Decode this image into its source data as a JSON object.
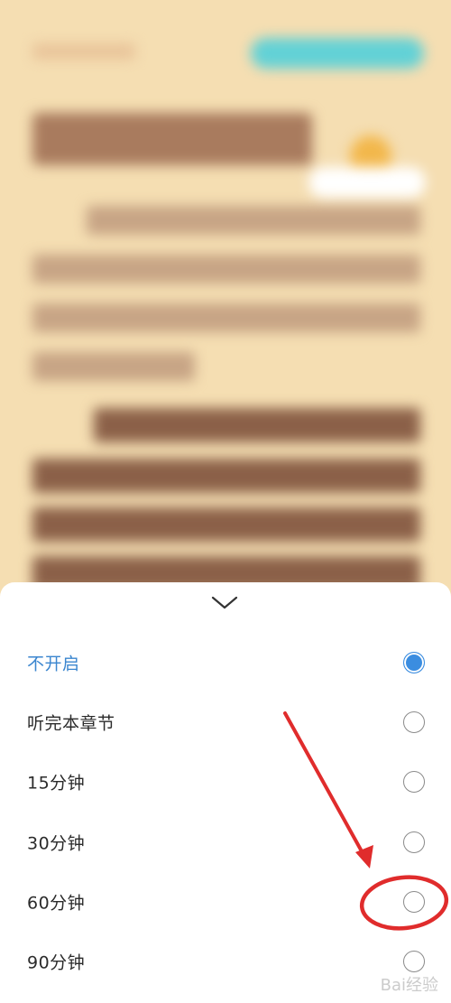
{
  "sheet": {
    "collapse_icon": "chevron-down-icon",
    "options": [
      {
        "label": "不开启",
        "selected": true
      },
      {
        "label": "听完本章节",
        "selected": false
      },
      {
        "label": "15分钟",
        "selected": false
      },
      {
        "label": "30分钟",
        "selected": false
      },
      {
        "label": "60分钟",
        "selected": false
      },
      {
        "label": "90分钟",
        "selected": false
      }
    ]
  },
  "colors": {
    "accent": "#3b8de0",
    "selected_text": "#3b86cf",
    "annotation": "#e02c2c",
    "page_background": "#f5deb2"
  },
  "watermark": {
    "text": "Bai经验"
  }
}
